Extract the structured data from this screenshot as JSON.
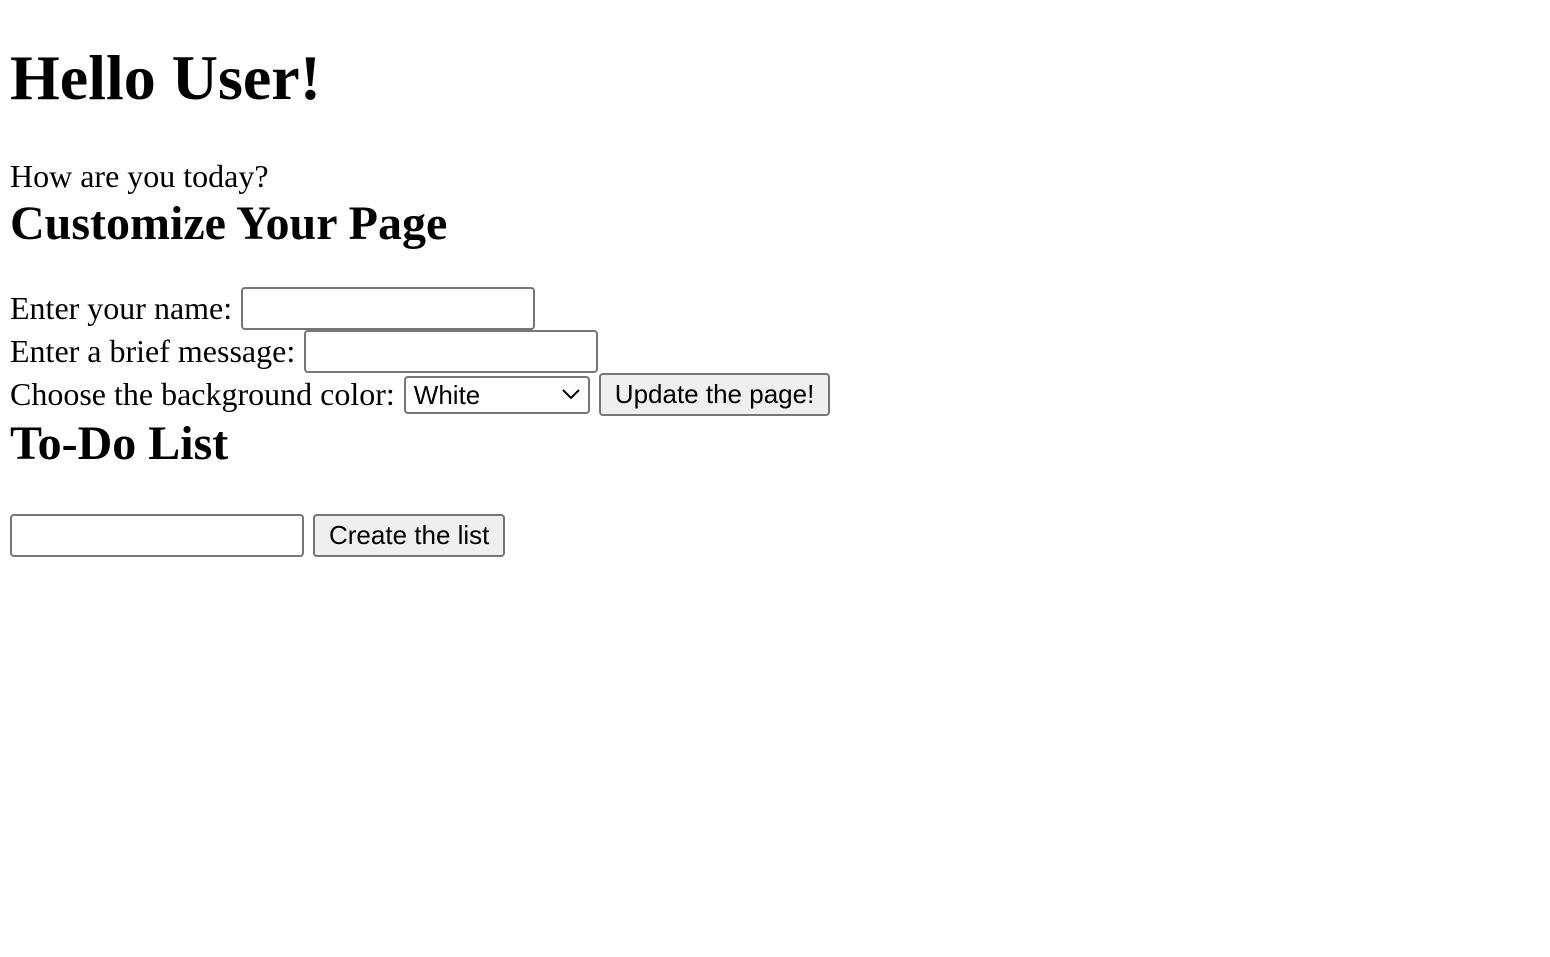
{
  "greeting": {
    "title": "Hello User!",
    "subtitle": "How are you today?"
  },
  "customize": {
    "heading": "Customize Your Page",
    "name_label": "Enter your name:",
    "name_value": "",
    "message_label": "Enter a brief message:",
    "message_value": "",
    "color_label": "Choose the background color:",
    "color_selected": "White",
    "update_button": "Update the page!"
  },
  "todo": {
    "heading": "To-Do List",
    "item_value": "",
    "create_button": "Create the list"
  }
}
